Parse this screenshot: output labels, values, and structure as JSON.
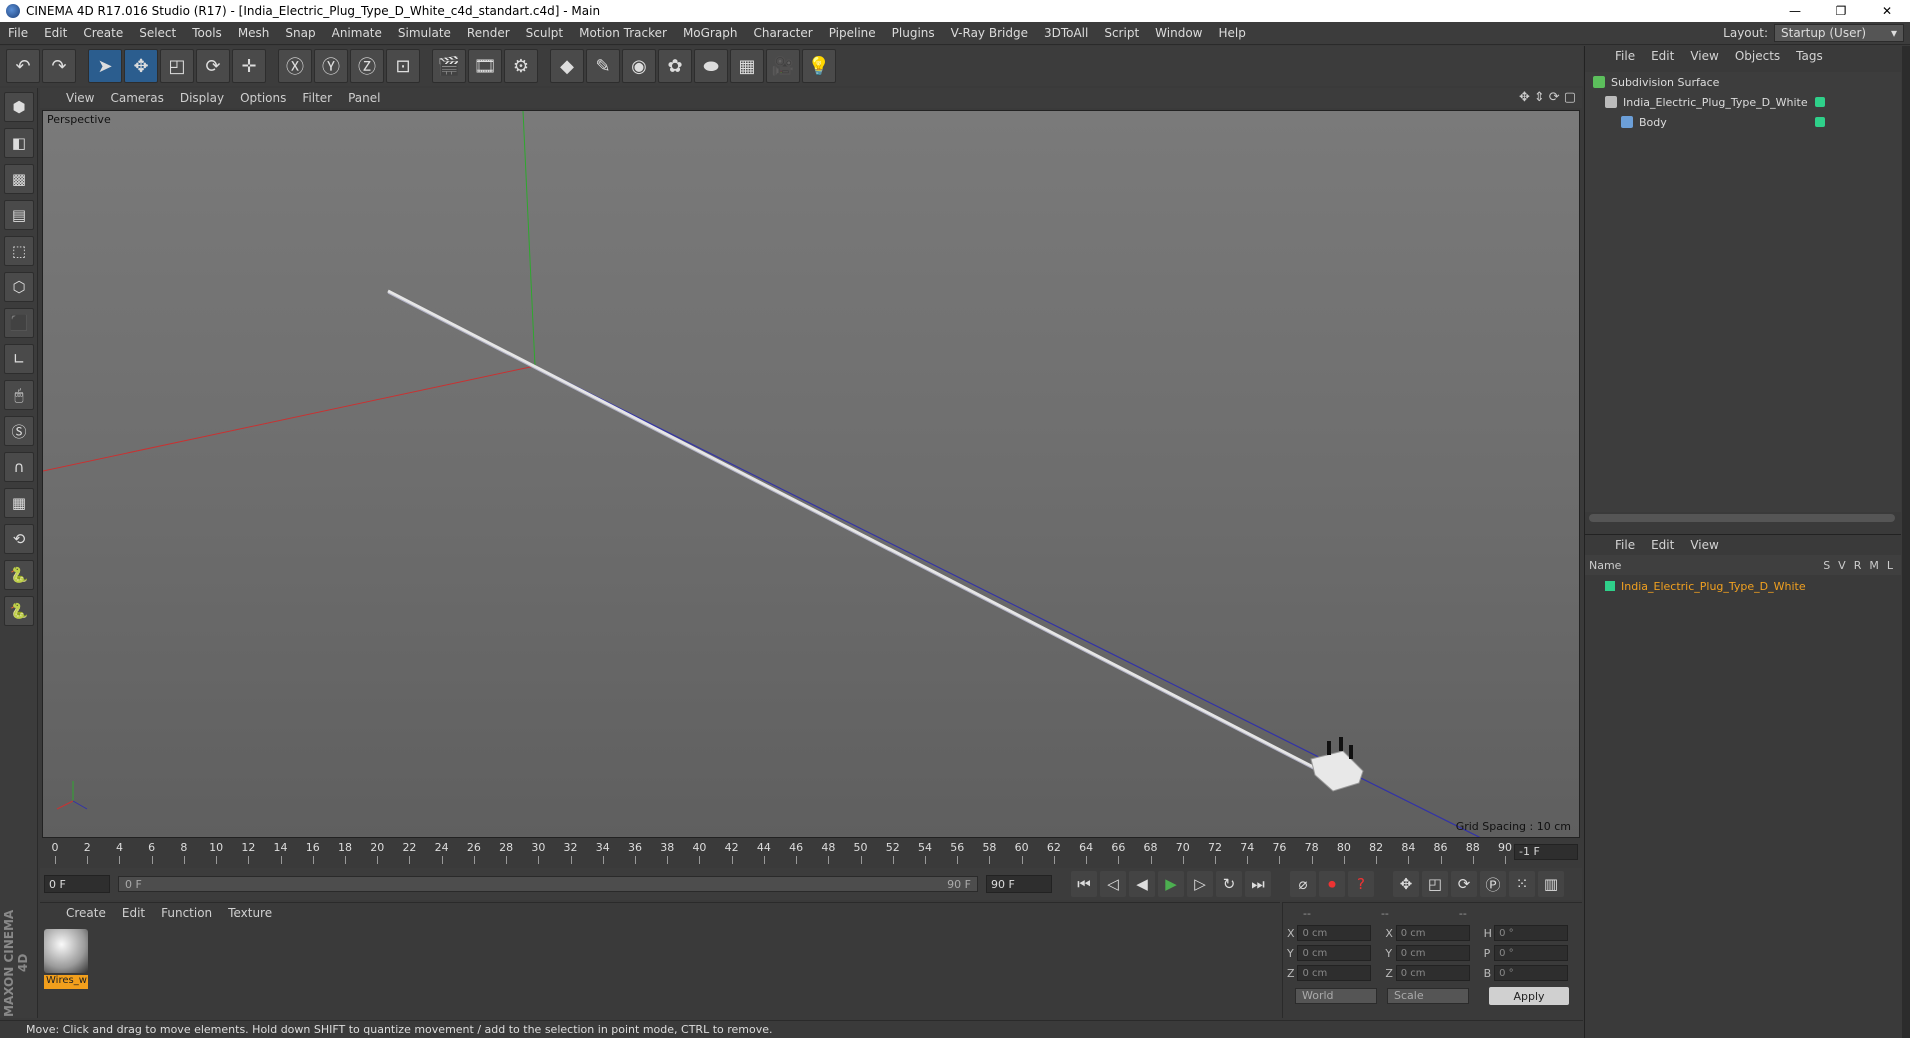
{
  "window": {
    "title": "CINEMA 4D R17.016 Studio (R17) - [India_Electric_Plug_Type_D_White_c4d_standart.c4d] - Main",
    "minimize": "—",
    "restore": "❐",
    "close": "✕"
  },
  "menu": [
    "File",
    "Edit",
    "Create",
    "Select",
    "Tools",
    "Mesh",
    "Snap",
    "Animate",
    "Simulate",
    "Render",
    "Sculpt",
    "Motion Tracker",
    "MoGraph",
    "Character",
    "Pipeline",
    "Plugins",
    "V-Ray Bridge",
    "3DToAll",
    "Script",
    "Window",
    "Help"
  ],
  "layout": {
    "label": "Layout:",
    "value": "Startup (User)"
  },
  "viewport": {
    "menu": [
      "View",
      "Cameras",
      "Display",
      "Options",
      "Filter",
      "Panel"
    ],
    "label": "Perspective",
    "grid_spacing": "Grid Spacing : 10 cm"
  },
  "timeline": {
    "ticks": [
      0,
      2,
      4,
      6,
      8,
      10,
      12,
      14,
      16,
      18,
      20,
      22,
      24,
      26,
      28,
      30,
      32,
      34,
      36,
      38,
      40,
      42,
      44,
      46,
      48,
      50,
      52,
      54,
      56,
      58,
      60,
      62,
      64,
      66,
      68,
      70,
      72,
      74,
      76,
      78,
      80,
      82,
      84,
      86,
      88,
      90
    ],
    "frame_right": "-1 F",
    "start_field": "0 F",
    "slider_start": "0 F",
    "slider_end": "90 F",
    "end_field": "90 F"
  },
  "materials": {
    "menu": [
      "Create",
      "Edit",
      "Function",
      "Texture"
    ],
    "items": [
      {
        "name": "Wires_w"
      }
    ]
  },
  "coords": {
    "headers": [
      "--",
      "--",
      "--"
    ],
    "rows": [
      {
        "a": "X",
        "v1": "0 cm",
        "b": "X",
        "v2": "0 cm",
        "c": "H",
        "v3": "0 °"
      },
      {
        "a": "Y",
        "v1": "0 cm",
        "b": "Y",
        "v2": "0 cm",
        "c": "P",
        "v3": "0 °"
      },
      {
        "a": "Z",
        "v1": "0 cm",
        "b": "Z",
        "v2": "0 cm",
        "c": "B",
        "v3": "0 °"
      }
    ],
    "mode": "World",
    "size_mode": "Scale",
    "apply": "Apply"
  },
  "objects": {
    "menu": [
      "File",
      "Edit",
      "View",
      "Objects",
      "Tags"
    ],
    "rows": [
      {
        "name": "Subdivision Surface",
        "indent": 0
      },
      {
        "name": "India_Electric_Plug_Type_D_White",
        "indent": 1
      },
      {
        "name": "Body",
        "indent": 2
      }
    ]
  },
  "layers": {
    "menu": [
      "File",
      "Edit",
      "View"
    ],
    "col_name": "Name",
    "cols": [
      "S",
      "V",
      "R",
      "M",
      "L"
    ],
    "rows": [
      {
        "name": "India_Electric_Plug_Type_D_White"
      }
    ]
  },
  "status": "Move: Click and drag to move elements. Hold down SHIFT to quantize movement / add to the selection in point mode, CTRL to remove.",
  "colors": {
    "accent": "#2b5d8e",
    "layer": "#2fd08a",
    "material_label": "#f29f1c"
  }
}
